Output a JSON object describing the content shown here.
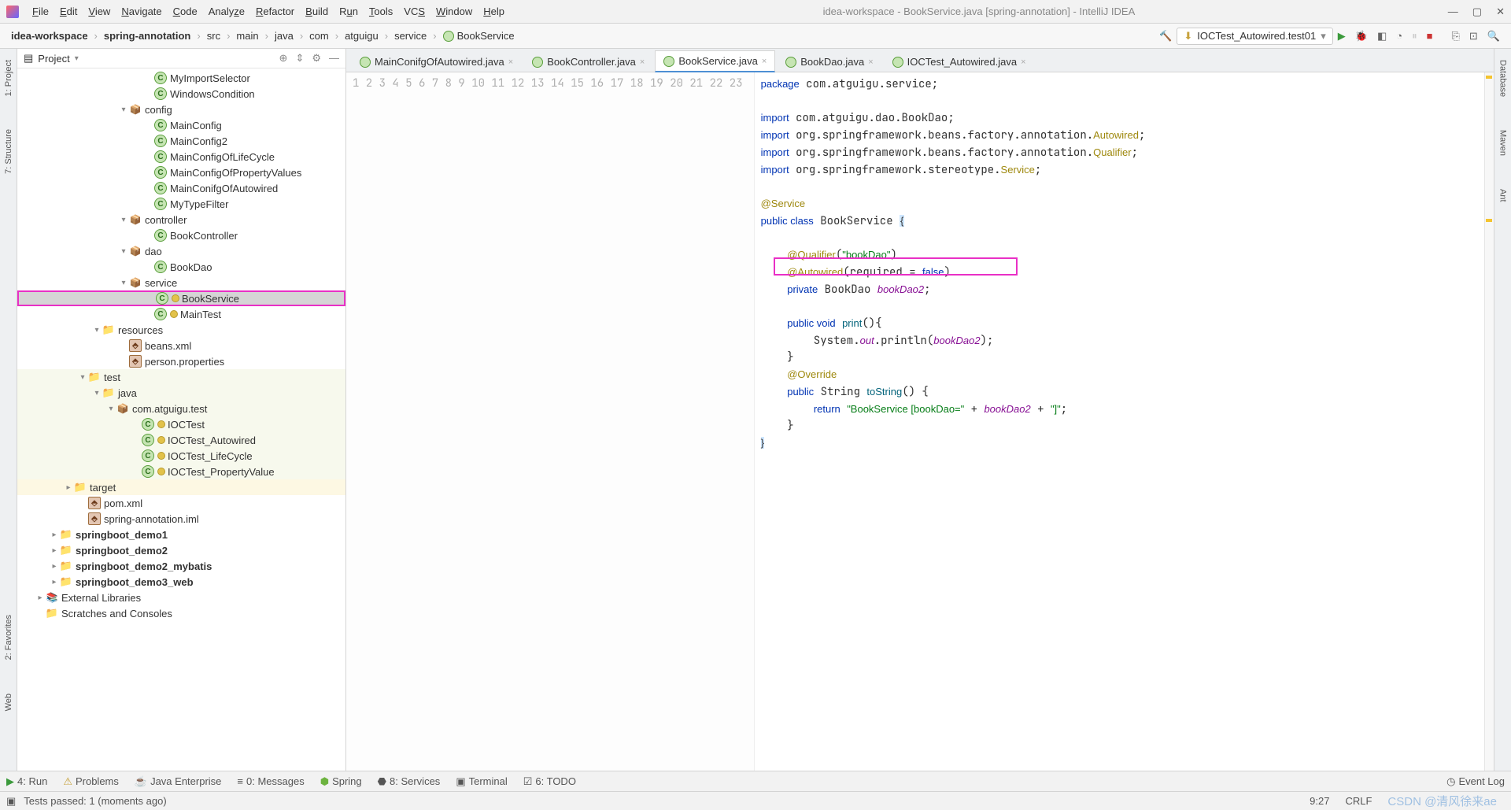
{
  "menubar": {
    "items": [
      "File",
      "Edit",
      "View",
      "Navigate",
      "Code",
      "Analyze",
      "Refactor",
      "Build",
      "Run",
      "Tools",
      "VCS",
      "Window",
      "Help"
    ],
    "title": "idea-workspace - BookService.java [spring-annotation] - IntelliJ IDEA"
  },
  "breadcrumbs": [
    "idea-workspace",
    "spring-annotation",
    "src",
    "main",
    "java",
    "com",
    "atguigu",
    "service",
    "BookService"
  ],
  "run_config": "IOCTest_Autowired.test01",
  "left_gutter": [
    "1: Project",
    "7: Structure",
    "2: Favorites",
    "Web"
  ],
  "right_gutter": [
    "Database",
    "Maven",
    "Ant"
  ],
  "sidebar": {
    "title": "Project",
    "tree": [
      {
        "indent": 160,
        "icon": "cls",
        "label": "MyImportSelector",
        "cut": true
      },
      {
        "indent": 160,
        "icon": "cls",
        "label": "WindowsCondition"
      },
      {
        "indent": 128,
        "arrow": "▾",
        "icon": "pkg",
        "label": "config"
      },
      {
        "indent": 160,
        "icon": "cls",
        "label": "MainConfig"
      },
      {
        "indent": 160,
        "icon": "cls",
        "label": "MainConfig2"
      },
      {
        "indent": 160,
        "icon": "cls",
        "label": "MainConfigOfLifeCycle"
      },
      {
        "indent": 160,
        "icon": "cls",
        "label": "MainConfigOfPropertyValues"
      },
      {
        "indent": 160,
        "icon": "cls",
        "label": "MainConifgOfAutowired"
      },
      {
        "indent": 160,
        "icon": "cls",
        "label": "MyTypeFilter"
      },
      {
        "indent": 128,
        "arrow": "▾",
        "icon": "pkg",
        "label": "controller"
      },
      {
        "indent": 160,
        "icon": "cls",
        "label": "BookController"
      },
      {
        "indent": 128,
        "arrow": "▾",
        "icon": "pkg",
        "label": "dao"
      },
      {
        "indent": 160,
        "icon": "cls",
        "label": "BookDao"
      },
      {
        "indent": 128,
        "arrow": "▾",
        "icon": "pkg",
        "label": "service"
      },
      {
        "indent": 160,
        "icon": "cls",
        "label": "BookService",
        "selected": true,
        "sub": true
      },
      {
        "indent": 160,
        "icon": "cls",
        "label": "MainTest",
        "sub": true
      },
      {
        "indent": 94,
        "arrow": "▾",
        "icon": "res",
        "label": "resources"
      },
      {
        "indent": 128,
        "icon": "xml",
        "label": "beans.xml"
      },
      {
        "indent": 128,
        "icon": "xml",
        "label": "person.properties"
      },
      {
        "indent": 76,
        "arrow": "▾",
        "icon": "folder",
        "label": "test",
        "light": true
      },
      {
        "indent": 94,
        "arrow": "▾",
        "icon": "folder",
        "label": "java",
        "light": true
      },
      {
        "indent": 112,
        "arrow": "▾",
        "icon": "pkg",
        "label": "com.atguigu.test",
        "light": true
      },
      {
        "indent": 144,
        "icon": "cls",
        "label": "IOCTest",
        "light": true,
        "sub": true
      },
      {
        "indent": 144,
        "icon": "cls",
        "label": "IOCTest_Autowired",
        "light": true,
        "sub": true
      },
      {
        "indent": 144,
        "icon": "cls",
        "label": "IOCTest_LifeCycle",
        "light": true,
        "sub": true
      },
      {
        "indent": 144,
        "icon": "cls",
        "label": "IOCTest_PropertyValue",
        "light": true,
        "sub": true
      },
      {
        "indent": 58,
        "arrow": "▸",
        "icon": "folder",
        "label": "target",
        "yellow": true
      },
      {
        "indent": 76,
        "icon": "xml",
        "label": "pom.xml",
        "maven": true
      },
      {
        "indent": 76,
        "icon": "xml",
        "label": "spring-annotation.iml"
      },
      {
        "indent": 40,
        "arrow": "▸",
        "icon": "folder",
        "label": "springboot_demo1",
        "bold": true
      },
      {
        "indent": 40,
        "arrow": "▸",
        "icon": "folder",
        "label": "springboot_demo2",
        "bold": true
      },
      {
        "indent": 40,
        "arrow": "▸",
        "icon": "folder",
        "label": "springboot_demo2_mybatis",
        "bold": true
      },
      {
        "indent": 40,
        "arrow": "▸",
        "icon": "folder",
        "label": "springboot_demo3_web",
        "bold": true
      },
      {
        "indent": 22,
        "arrow": "▸",
        "icon": "lib",
        "label": "External Libraries"
      },
      {
        "indent": 22,
        "icon": "folder",
        "label": "Scratches and Consoles",
        "scratch": true
      }
    ]
  },
  "tabs": [
    {
      "label": "MainConifgOfAutowired.java"
    },
    {
      "label": "BookController.java"
    },
    {
      "label": "BookService.java",
      "active": true
    },
    {
      "label": "BookDao.java"
    },
    {
      "label": "IOCTest_Autowired.java"
    }
  ],
  "code_lines": [
    1,
    2,
    3,
    4,
    5,
    6,
    7,
    8,
    9,
    10,
    11,
    12,
    13,
    14,
    15,
    16,
    17,
    18,
    19,
    20,
    21,
    22,
    23
  ],
  "bottom_tools": [
    "4: Run",
    "Problems",
    "Java Enterprise",
    "0: Messages",
    "Spring",
    "8: Services",
    "Terminal",
    "6: TODO"
  ],
  "event_log": "Event Log",
  "statusbar": {
    "msg": "Tests passed: 1 (moments ago)",
    "pos": "9:27",
    "insert": "CRLF",
    "watermark": "CSDN @清风徐来ae",
    "sp": " "
  }
}
